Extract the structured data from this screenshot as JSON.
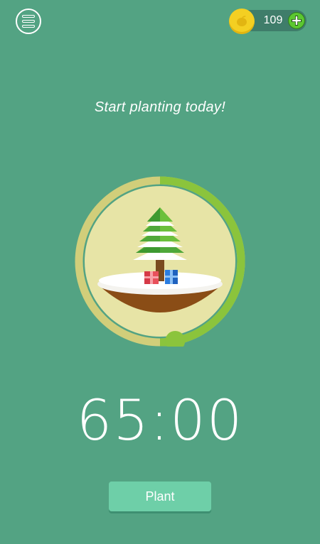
{
  "header": {
    "menu_icon": "menu-icon",
    "coin_icon": "seed-coin-icon",
    "coins": "109",
    "add_icon": "plus-icon"
  },
  "main": {
    "tagline": "Start planting today!",
    "tree_icon": "snowy-pine-tree-with-gifts",
    "timer": "65:00",
    "progress_fraction": 0.5
  },
  "footer": {
    "plant_label": "Plant"
  },
  "colors": {
    "background": "#53a383",
    "ring_track": "#d1ce7a",
    "ring_progress": "#8bc43c",
    "ring_inner": "#e7e4a6",
    "button": "#6ecfa8",
    "coin": "#f4cf22",
    "add": "#5cc730"
  }
}
